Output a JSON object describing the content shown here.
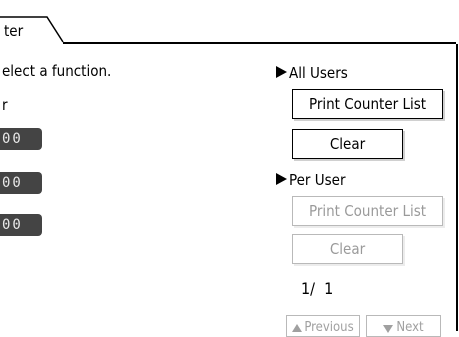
{
  "tab": {
    "label": "ter"
  },
  "prompt": "elect a function.",
  "sublabel": "r",
  "counters": [
    {
      "value": "00"
    },
    {
      "value": "00"
    },
    {
      "value": "00"
    }
  ],
  "all_users": {
    "label": "All Users",
    "print_button": "Print Counter List",
    "clear_button": "Clear"
  },
  "per_user": {
    "label": "Per User",
    "print_button": "Print Counter List",
    "clear_button": "Clear"
  },
  "pagination": {
    "current": "1/",
    "total": "1",
    "previous_label": "Previous",
    "next_label": "Next"
  },
  "colors": {
    "counter_bg": "#444444",
    "disabled_text": "#9a9a9a"
  }
}
